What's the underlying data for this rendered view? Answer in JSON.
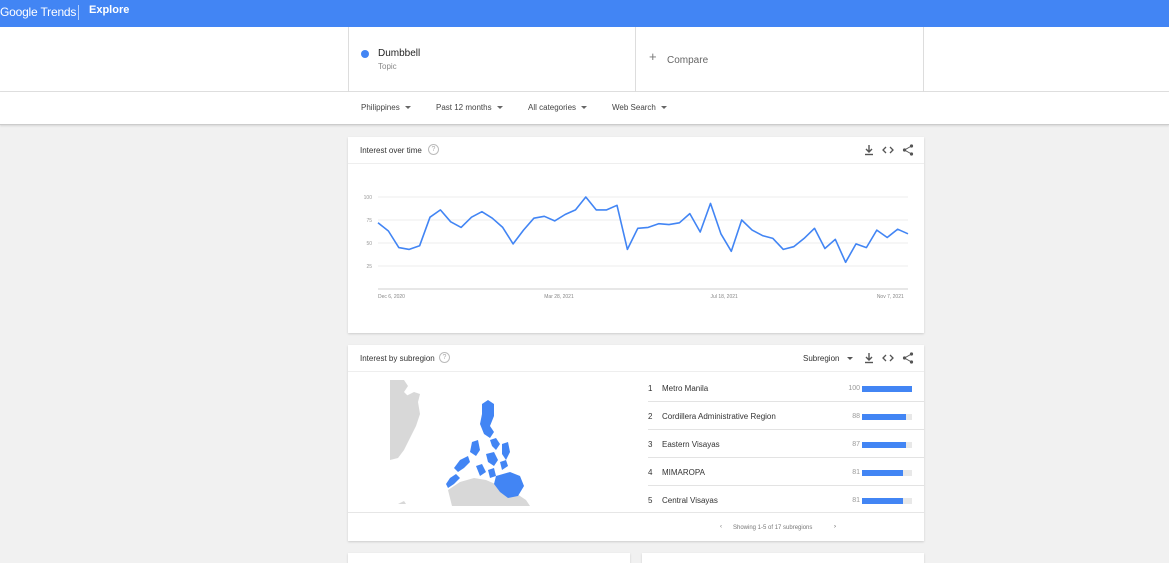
{
  "header": {
    "logo_google": "Google",
    "logo_trends": "Trends",
    "section": "Explore"
  },
  "search": {
    "term": {
      "name": "Dumbbell",
      "type": "Topic",
      "color": "#4285f4"
    },
    "compare_label": "Compare"
  },
  "filters": [
    "Philippines",
    "Past 12 months",
    "All categories",
    "Web Search"
  ],
  "interest_over_time": {
    "title": "Interest over time",
    "help": "?",
    "icons": [
      "download-icon",
      "embed-icon",
      "share-icon"
    ]
  },
  "chart_data": {
    "type": "line",
    "title": "Interest over time",
    "xlabel": "",
    "ylabel": "",
    "ylim": [
      0,
      100
    ],
    "y_ticks": [
      "100",
      "75",
      "50",
      "25"
    ],
    "x_tick_labels": [
      "Dec 6, 2020",
      "Mar 28, 2021",
      "Jul 18, 2021",
      "Nov 7, 2021"
    ],
    "x_tick_index": [
      0,
      16,
      32,
      48
    ],
    "grid": true,
    "series": [
      {
        "color": "#4285f4",
        "values": [
          72,
          63,
          45,
          43,
          47,
          78,
          86,
          73,
          67,
          78,
          84,
          77,
          67,
          49,
          64,
          77,
          79,
          74,
          81,
          86,
          100,
          86,
          86,
          91,
          43,
          66,
          67,
          71,
          70,
          72,
          82,
          62,
          93,
          60,
          41,
          75,
          64,
          58,
          55,
          43,
          46,
          55,
          66,
          44,
          54,
          29,
          49,
          45,
          64,
          56,
          65,
          60
        ]
      }
    ]
  },
  "interest_by_subregion": {
    "title": "Interest by subregion",
    "help": "?",
    "resolution": "Subregion",
    "rows": [
      {
        "rank": "1",
        "name": "Metro Manila",
        "value": 100
      },
      {
        "rank": "2",
        "name": "Cordillera Administrative Region",
        "value": 88
      },
      {
        "rank": "3",
        "name": "Eastern Visayas",
        "value": 87
      },
      {
        "rank": "4",
        "name": "MIMAROPA",
        "value": 81
      },
      {
        "rank": "5",
        "name": "Central Visayas",
        "value": 81
      }
    ],
    "pagination": "Showing 1-5 of 17 subregions",
    "map_colors": {
      "highlight": "#4285f4",
      "land": "#d6d6d6",
      "water": "#ffffff"
    }
  }
}
